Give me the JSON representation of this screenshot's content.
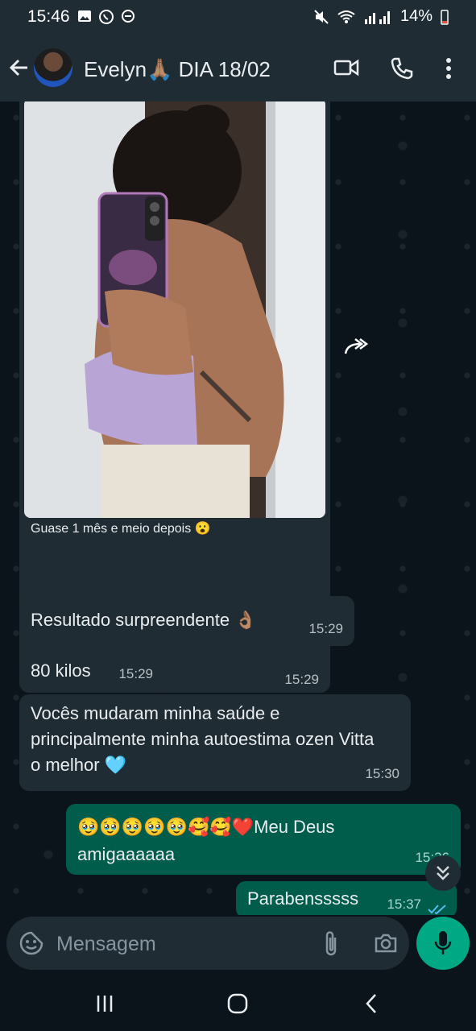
{
  "status_bar": {
    "time": "15:46",
    "battery": "14%"
  },
  "header": {
    "contact_name": "Evelyn🙏🏽 DIA 18/02"
  },
  "messages": [
    {
      "text": "Guase 1 mês e meio depois 😮",
      "time": "15:29",
      "direction": "in"
    },
    {
      "text": "Resultado surpreendente 👌🏽",
      "time": "15:29",
      "direction": "in"
    },
    {
      "text": "80 kilos",
      "time": "15:29",
      "direction": "in"
    },
    {
      "text": "Vocês mudaram minha saúde e principalmente minha autoestima ozen Vitta o melhor 🩵",
      "time": "15:30",
      "direction": "in"
    },
    {
      "text": "🥹🥹🥹🥹🥹🥰🥰❤️Meu Deus amigaaaaaa",
      "time": "15:36",
      "direction": "out"
    },
    {
      "text": "Parabensssss",
      "time": "15:37",
      "direction": "out",
      "status": "read"
    }
  ],
  "composer": {
    "placeholder": "Mensagem"
  },
  "colors": {
    "incoming": "#202c33",
    "outgoing": "#005c4b",
    "accent": "#00a884",
    "read_ticks": "#53bdeb"
  }
}
